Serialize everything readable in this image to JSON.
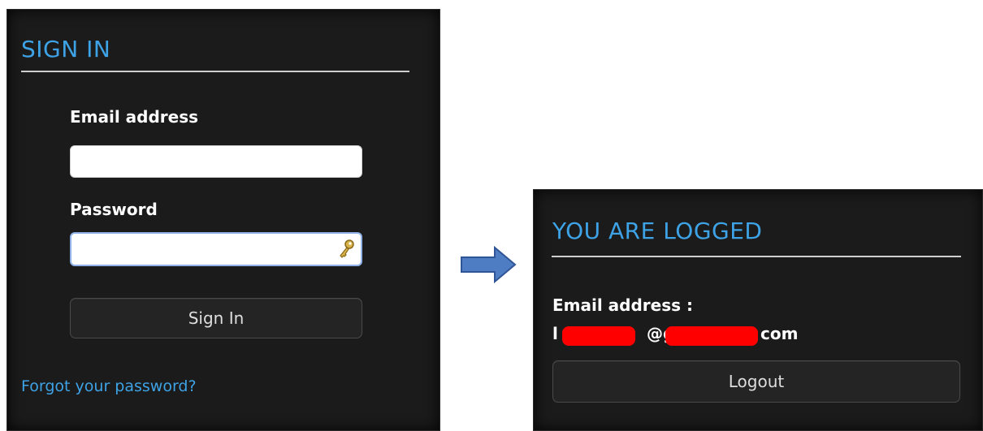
{
  "signin": {
    "title": "SIGN IN",
    "email_label": "Email address",
    "email_value": "",
    "password_label": "Password",
    "password_value": "",
    "submit_label": "Sign In",
    "forgot_link": "Forgot your password?"
  },
  "logged": {
    "title": "YOU ARE LOGGED",
    "email_label": "Email address :",
    "email_fragments": [
      "l",
      "@g",
      "com"
    ],
    "logout_label": "Logout"
  },
  "colors": {
    "panel_bg": "#1b1b1b",
    "accent": "#3ea3e6",
    "redaction": "#ff0000",
    "arrow_fill": "#4f7dc4",
    "arrow_stroke": "#2f5597"
  },
  "icons": [
    "key-icon",
    "right-arrow-icon"
  ]
}
